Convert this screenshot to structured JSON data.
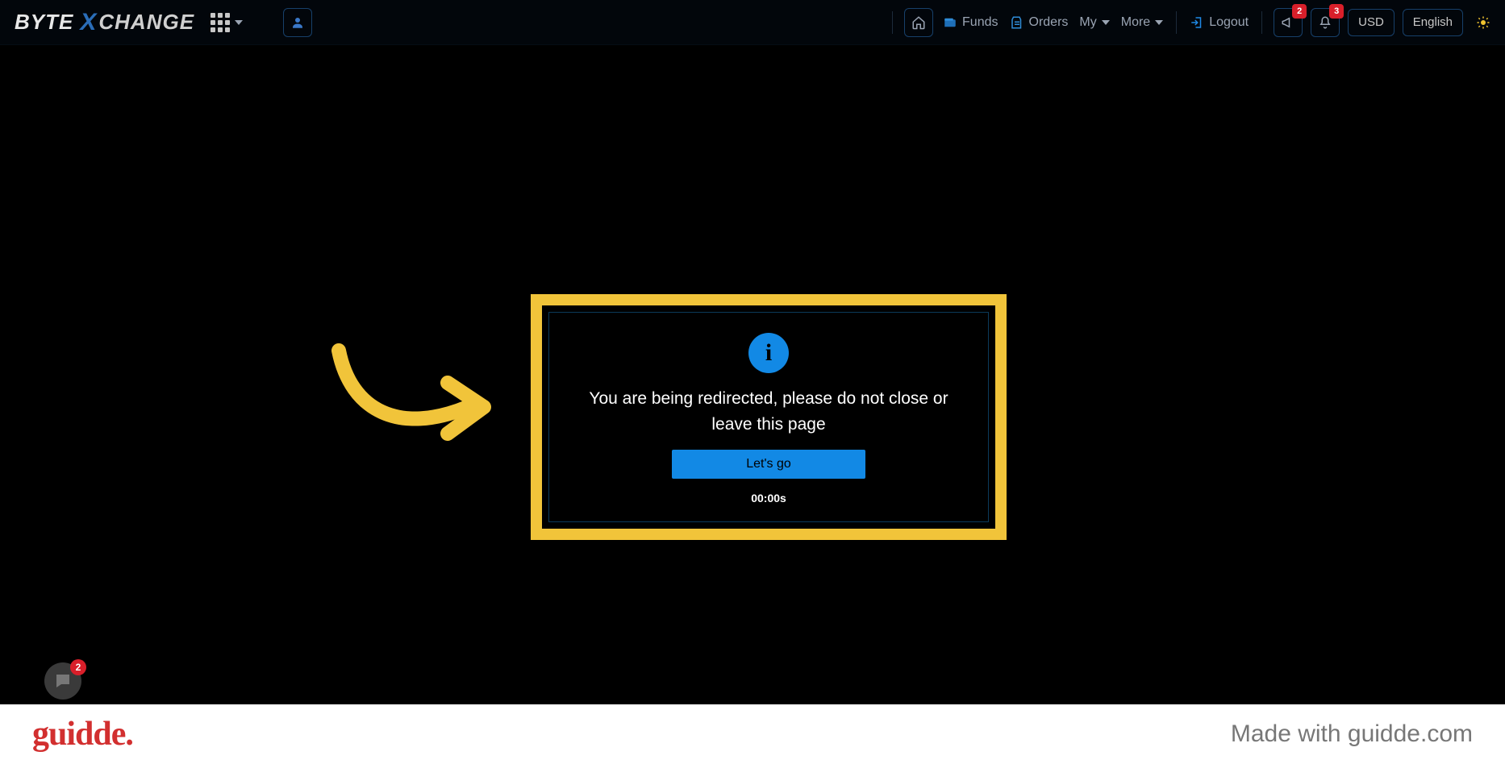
{
  "brand": {
    "byte": "BYTE",
    "x": "X",
    "rest": "CHANGE"
  },
  "nav": {
    "funds": "Funds",
    "orders": "Orders",
    "my": "My",
    "more": "More",
    "logout": "Logout",
    "currency": "USD",
    "language": "English",
    "announce_badge": "2",
    "bell_badge": "3"
  },
  "modal": {
    "message": "You are being redirected, please do not close or leave this page",
    "button": "Let's go",
    "timer": "00:00s"
  },
  "chat": {
    "badge": "2"
  },
  "footer": {
    "brand": "guidde.",
    "tagline": "Made with guidde.com"
  }
}
